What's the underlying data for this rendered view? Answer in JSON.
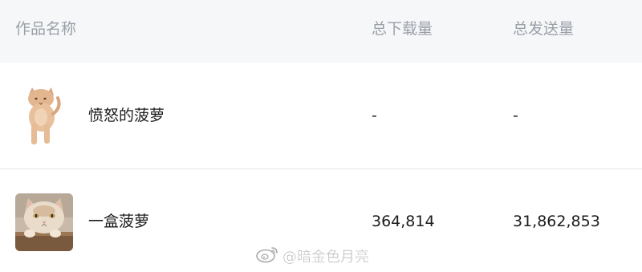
{
  "header": {
    "col_name": "作品名称",
    "col_downloads": "总下载量",
    "col_sends": "总发送量"
  },
  "rows": [
    {
      "name": "愤怒的菠萝",
      "downloads": "-",
      "sends": "-",
      "thumb_icon": "standing-orange-cat-icon"
    },
    {
      "name": "一盒菠萝",
      "downloads": "364,814",
      "sends": "31,862,853",
      "thumb_icon": "cat-in-box-icon"
    }
  ],
  "watermark": {
    "logo_icon": "weibo-logo-icon",
    "text": "@暗金色月亮"
  },
  "colors": {
    "header_bg": "#f6f7f9",
    "header_text": "#9aa0a8",
    "body_text": "#1c1c1c",
    "divider": "#e3e5e8"
  }
}
